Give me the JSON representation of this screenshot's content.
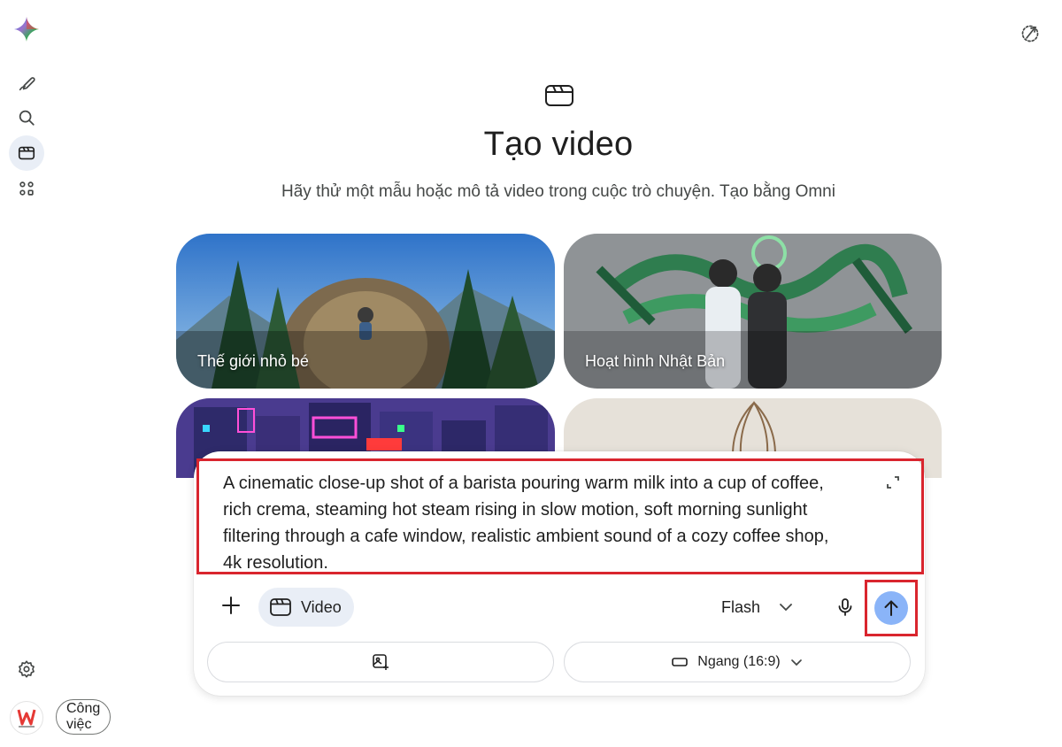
{
  "hero": {
    "title": "Tạo video",
    "subtitle": "Hãy thử một mẫu hoặc mô tả video trong cuộc trò chuyện. Tạo bằng Omni"
  },
  "cards": [
    {
      "label": "Thế giới nhỏ bé"
    },
    {
      "label": "Hoạt hình Nhật Bản"
    },
    {
      "label": ""
    },
    {
      "label": ""
    }
  ],
  "composer": {
    "prompt": "A cinematic close-up shot of a barista pouring warm milk into a cup of coffee, rich crema, steaming hot steam rising in slow motion, soft morning sunlight filtering through a cafe window, realistic ambient sound of a cozy coffee shop, 4k resolution.",
    "mode_label": "Video",
    "model_label": "Flash",
    "aspect_label": "Ngang (16:9)"
  },
  "sidebar": {
    "work_label": "Công việc"
  },
  "colors": {
    "accent_send": "#8ab4f8",
    "highlight": "#d9252e",
    "chip_bg": "#e9eef6"
  },
  "icons": {
    "brand": "gemini-spark-icon",
    "new_chat": "edit-pencil-icon",
    "search": "search-icon",
    "video": "clapper-icon",
    "apps": "apps-grid-icon",
    "settings": "gear-icon"
  }
}
